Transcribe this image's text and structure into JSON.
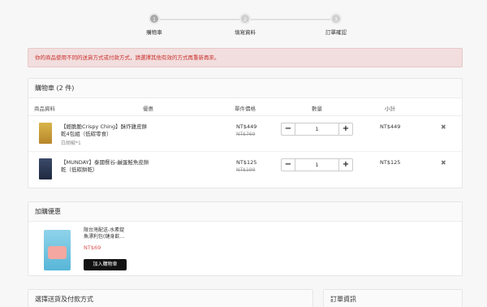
{
  "steps": [
    {
      "num": "1",
      "label": "購物車"
    },
    {
      "num": "2",
      "label": "填寫資料"
    },
    {
      "num": "3",
      "label": "訂單確認"
    }
  ],
  "alert": {
    "text": "你的商品使用不同的送貨方式或付款方式，請選擇其他有效的方式再重新再來。"
  },
  "cart": {
    "title": "購物車 (2 件)",
    "columns": {
      "product": "商品資料",
      "discount": "優惠",
      "unit_price": "單件價格",
      "quantity": "數量",
      "subtotal": "小計"
    },
    "items": [
      {
        "name": "【經脆脆Crispy Ching】酥炸雞皮餅乾4包組（低碳零食）",
        "variant": "白胡椒*1",
        "price": "NT$449",
        "original_price": "NT$769",
        "quantity": "1",
        "subtotal": "NT$449"
      },
      {
        "name": "【MUNDAY】泰國餐谷-鹹蛋鮭魚皮餅乾（低碳餅乾）",
        "variant": "",
        "price": "NT$125",
        "original_price": "NT$199",
        "quantity": "1",
        "subtotal": "NT$125"
      }
    ],
    "minus": "−",
    "plus": "+",
    "remove": "✖"
  },
  "upsell": {
    "title": "加購優惠",
    "item": {
      "name": "限台灣配送-水素錠 魚漂利包(鏈身飲…",
      "price": "NT$69",
      "button": "加入購物車"
    }
  },
  "shipping": {
    "title": "選擇送貨及付款方式"
  },
  "order_info": {
    "title": "訂單資訊"
  }
}
